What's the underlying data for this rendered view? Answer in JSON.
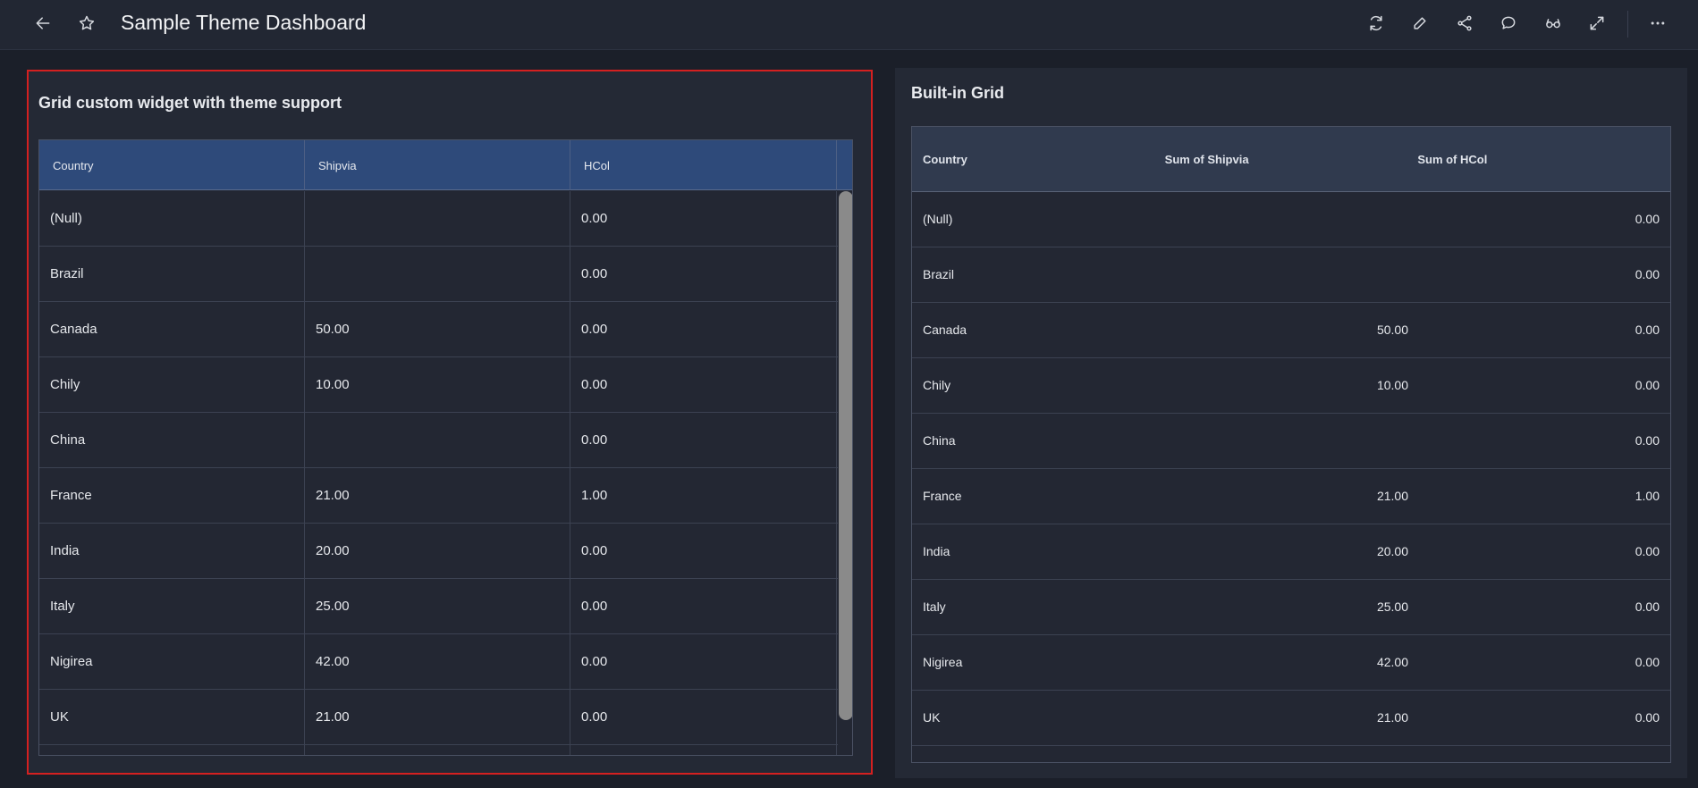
{
  "header": {
    "title": "Sample Theme Dashboard",
    "left_icons": [
      "back-arrow-icon",
      "star-icon"
    ],
    "right_icons": [
      "refresh-icon",
      "edit-pencil-icon",
      "share-icon",
      "comment-icon",
      "view-glasses-icon",
      "expand-icon",
      "more-options-icon"
    ]
  },
  "left_panel": {
    "title": "Grid custom widget with theme support",
    "columns": [
      "Country",
      "Shipvia",
      "HCol"
    ],
    "rows": [
      {
        "country": "(Null)",
        "shipvia": "",
        "hcol": "0.00"
      },
      {
        "country": "Brazil",
        "shipvia": "",
        "hcol": "0.00"
      },
      {
        "country": "Canada",
        "shipvia": "50.00",
        "hcol": "0.00"
      },
      {
        "country": "Chily",
        "shipvia": "10.00",
        "hcol": "0.00"
      },
      {
        "country": "China",
        "shipvia": "",
        "hcol": "0.00"
      },
      {
        "country": "France",
        "shipvia": "21.00",
        "hcol": "1.00"
      },
      {
        "country": "India",
        "shipvia": "20.00",
        "hcol": "0.00"
      },
      {
        "country": "Italy",
        "shipvia": "25.00",
        "hcol": "0.00"
      },
      {
        "country": "Nigirea",
        "shipvia": "42.00",
        "hcol": "0.00"
      },
      {
        "country": "UK",
        "shipvia": "21.00",
        "hcol": "0.00"
      }
    ]
  },
  "right_panel": {
    "title": "Built-in Grid",
    "columns": [
      "Country",
      "Sum of Shipvia",
      "Sum of HCol"
    ],
    "rows": [
      {
        "country": "(Null)",
        "shipvia": "",
        "hcol": "0.00"
      },
      {
        "country": "Brazil",
        "shipvia": "",
        "hcol": "0.00"
      },
      {
        "country": "Canada",
        "shipvia": "50.00",
        "hcol": "0.00"
      },
      {
        "country": "Chily",
        "shipvia": "10.00",
        "hcol": "0.00"
      },
      {
        "country": "China",
        "shipvia": "",
        "hcol": "0.00"
      },
      {
        "country": "France",
        "shipvia": "21.00",
        "hcol": "1.00"
      },
      {
        "country": "India",
        "shipvia": "20.00",
        "hcol": "0.00"
      },
      {
        "country": "Italy",
        "shipvia": "25.00",
        "hcol": "0.00"
      },
      {
        "country": "Nigirea",
        "shipvia": "42.00",
        "hcol": "0.00"
      },
      {
        "country": "UK",
        "shipvia": "21.00",
        "hcol": "0.00"
      }
    ]
  },
  "colors": {
    "background": "#1b1f29",
    "panel": "#242935",
    "custom_header": "#2e4a7a",
    "builtin_header": "#303a4e",
    "selection_border": "#d42020"
  }
}
